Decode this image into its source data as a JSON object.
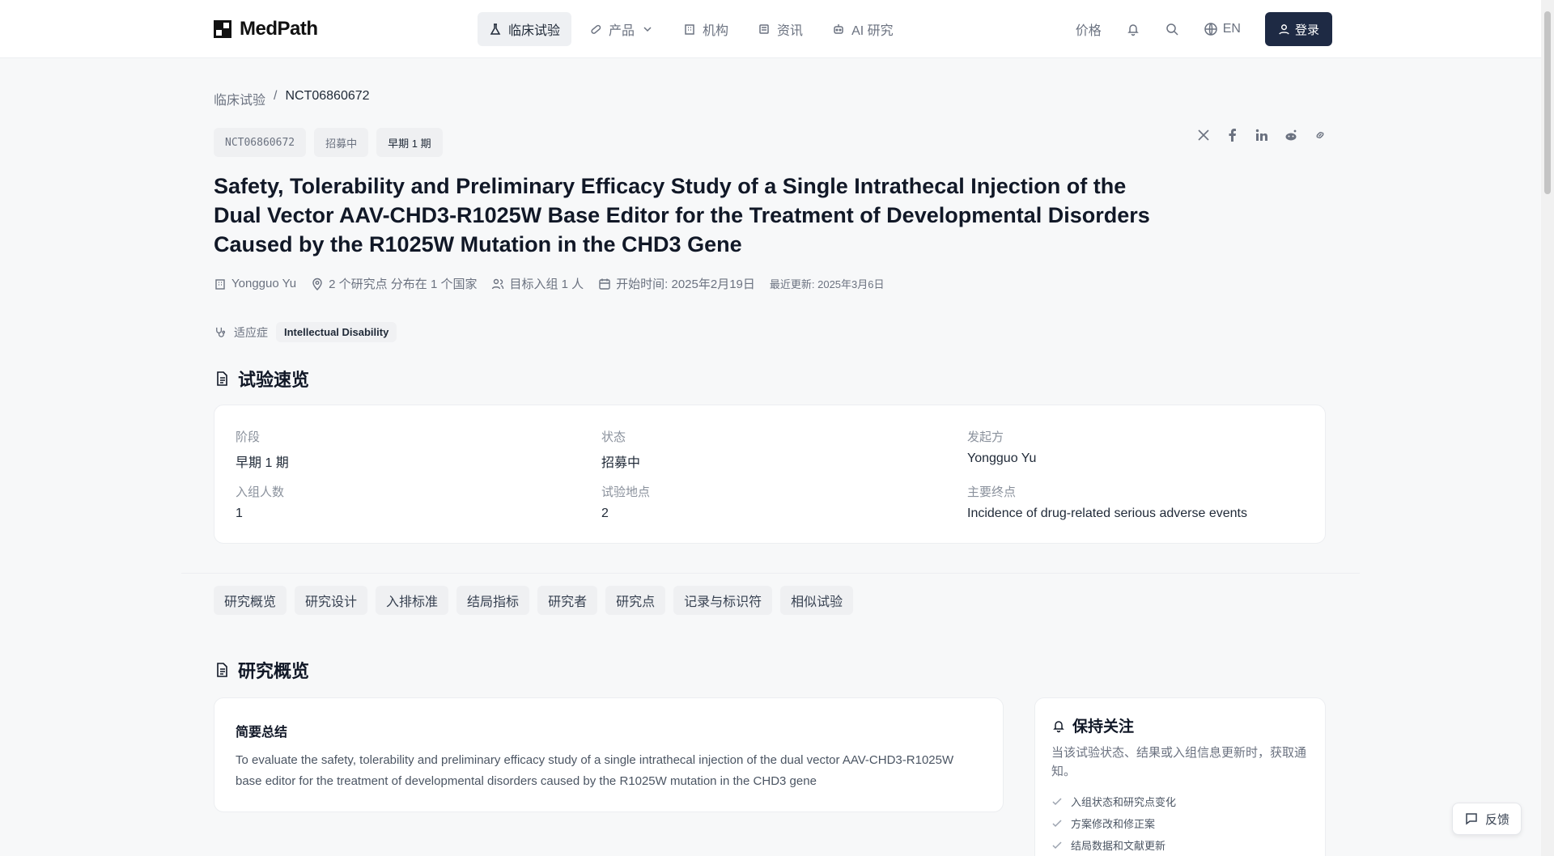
{
  "brand": {
    "name": "MedPath"
  },
  "nav": {
    "items": [
      {
        "label": "临床试验",
        "icon": "flask-icon"
      },
      {
        "label": "产品",
        "icon": "pill-icon"
      },
      {
        "label": "机构",
        "icon": "building-icon"
      },
      {
        "label": "资讯",
        "icon": "newspaper-icon"
      },
      {
        "label": "AI 研究",
        "icon": "robot-icon"
      }
    ],
    "price": "价格",
    "lang": "EN",
    "login": "登录"
  },
  "breadcrumb": {
    "root": "临床试验",
    "sep": "/",
    "current": "NCT06860672"
  },
  "tags": {
    "id": "NCT06860672",
    "status": "招募中",
    "phase": "早期 1 期"
  },
  "trial": {
    "title": "Safety, Tolerability and Preliminary Efficacy Study of a Single Intrathecal Injection of the Dual Vector AAV-CHD3-R1025W Base Editor for the Treatment of Developmental Disorders Caused by the R1025W Mutation in the CHD3 Gene",
    "sponsor": "Yongguo Yu",
    "sites": "2 个研究点 分布在 1 个国家",
    "enrollment": "目标入组 1 人",
    "start": "开始时间: 2025年2月19日",
    "updated": "最近更新: 2025年3月6日",
    "indication_label": "适应症",
    "indication": "Intellectual Disability"
  },
  "overview": {
    "title": "试验速览",
    "phase_label": "阶段",
    "phase": "早期 1 期",
    "status_label": "状态",
    "status": "招募中",
    "sponsor_label": "发起方",
    "sponsor": "Yongguo Yu",
    "enroll_label": "入组人数",
    "enroll": "1",
    "sites_label": "试验地点",
    "sites": "2",
    "endpoint_label": "主要终点",
    "endpoint": "Incidence of drug-related serious adverse events"
  },
  "tabs": [
    "研究概览",
    "研究设计",
    "入排标准",
    "结局指标",
    "研究者",
    "研究点",
    "记录与标识符",
    "相似试验"
  ],
  "study": {
    "title": "研究概览",
    "summary_title": "简要总结",
    "summary": "To evaluate the safety, tolerability and preliminary efficacy study of a single intrathecal injection of the dual vector AAV-CHD3-R1025W base editor for the treatment of developmental disorders caused by the R1025W mutation in the CHD3 gene"
  },
  "follow": {
    "title": "保持关注",
    "desc": "当该试验状态、结果或入组信息更新时，获取通知。",
    "items": [
      "入组状态和研究点变化",
      "方案修改和修正案",
      "结局数据和文献更新"
    ]
  },
  "feedback": "反馈",
  "colors": {
    "accent": "#1e2a44",
    "bg": "#f7f8f9"
  }
}
